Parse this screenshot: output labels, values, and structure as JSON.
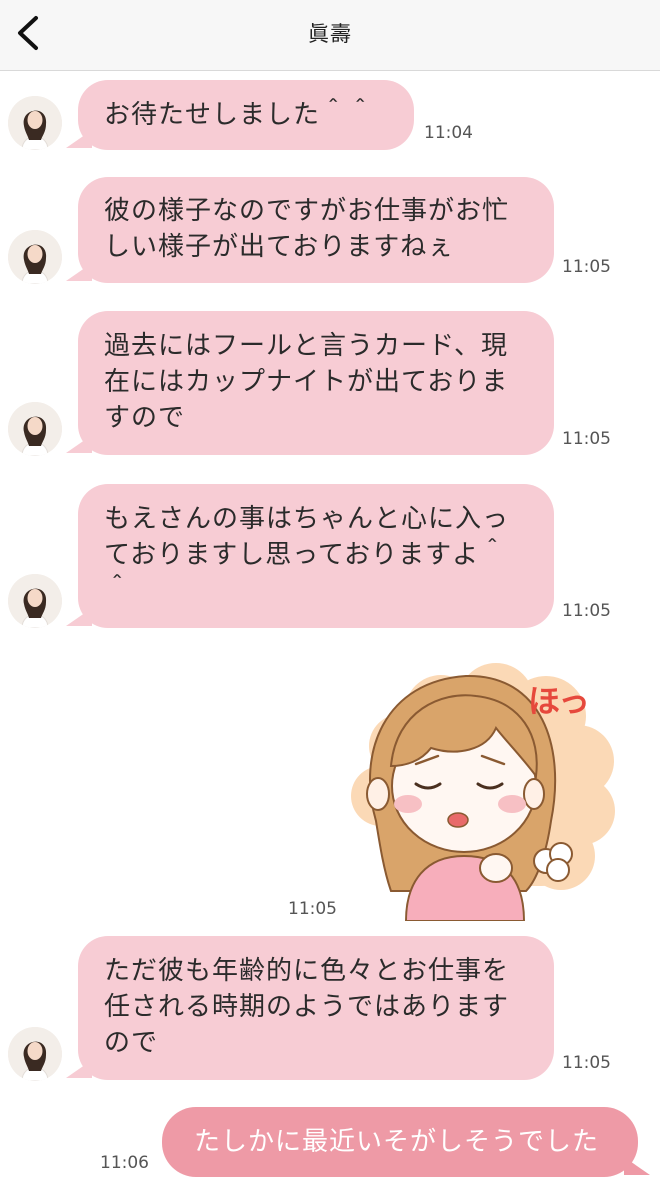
{
  "header": {
    "title": "眞壽",
    "back_icon": "chevron-left-icon"
  },
  "messages": [
    {
      "type": "incoming",
      "text": "お待たせしました＾＾",
      "time": "11:04"
    },
    {
      "type": "incoming",
      "text": "彼の様子なのですがお仕事がお忙しい様子が出ておりますねぇ",
      "time": "11:05"
    },
    {
      "type": "incoming",
      "text": "過去にはフールと言うカード、現在にはカップナイトが出ておりますので",
      "time": "11:05"
    },
    {
      "type": "incoming",
      "text": "もえさんの事はちゃんと心に入っておりますし思っておりますよ＾＾",
      "time": "11:05"
    },
    {
      "type": "sticker",
      "text": "ほっ",
      "time": "11:05"
    },
    {
      "type": "incoming",
      "text": "ただ彼も年齢的に色々とお仕事を任される時期のようではありますので",
      "time": "11:05"
    },
    {
      "type": "outgoing",
      "text": "たしかに最近いそがしそうでした",
      "time": "11:06"
    }
  ],
  "colors": {
    "incoming_bubble": "#f7ccd4",
    "outgoing_bubble": "#ee9aa6",
    "header_bg": "#f7f7f7"
  }
}
